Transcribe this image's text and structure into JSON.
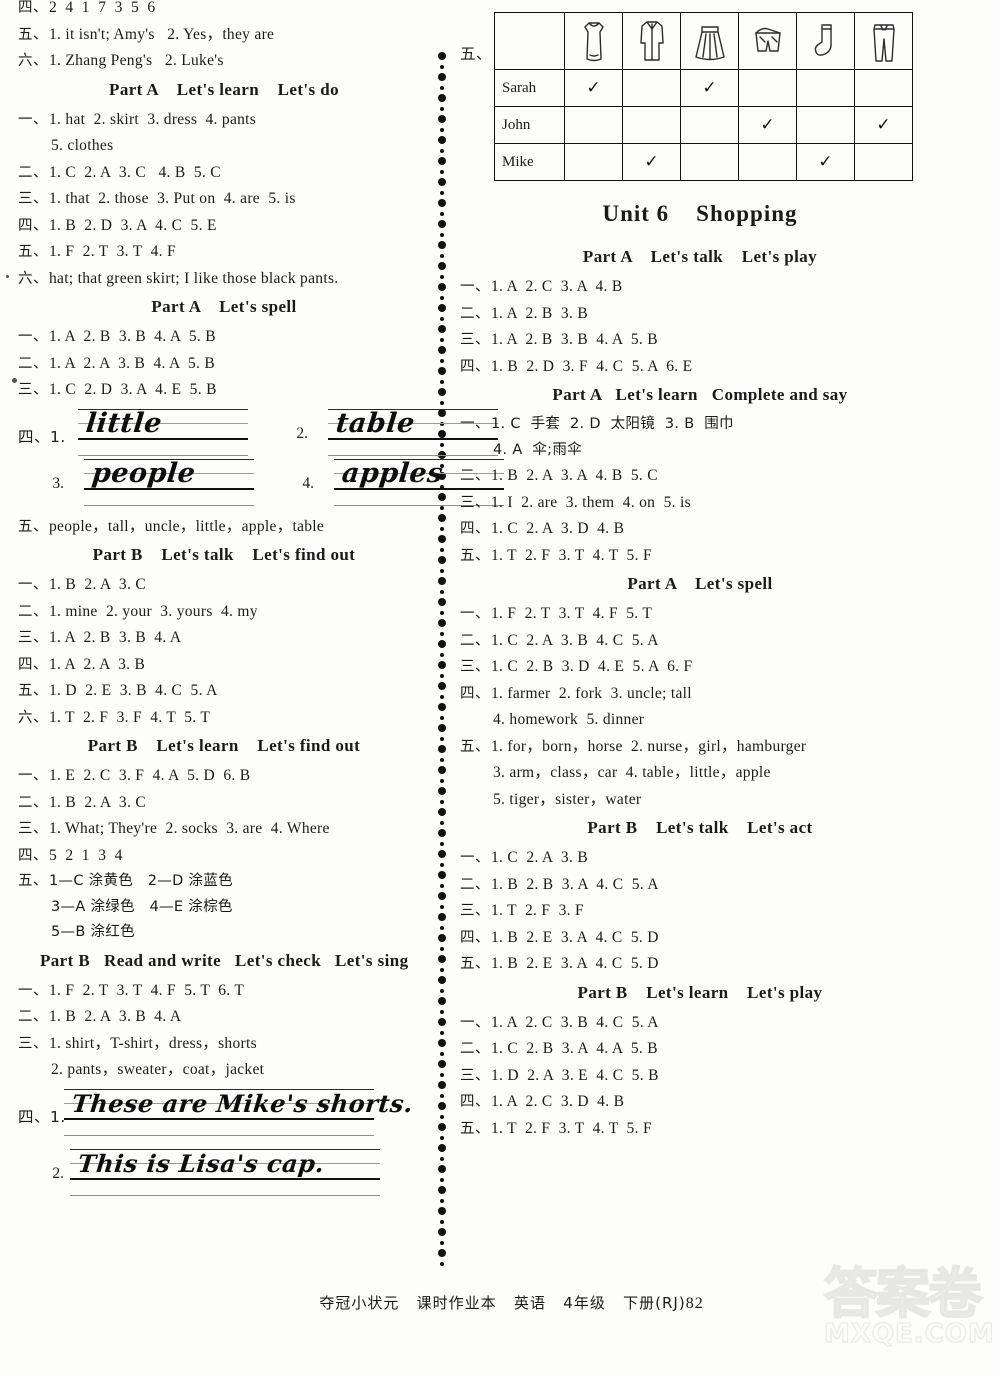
{
  "left_column": [
    {
      "kind": "answer",
      "num": "四、",
      "text": "2  4  1  7  3  5  6"
    },
    {
      "kind": "answer",
      "num": "五、",
      "text": "1. it isn't; Amy's   2. Yes，they are"
    },
    {
      "kind": "answer",
      "num": "六、",
      "text": "1. Zhang Peng's   2. Luke's"
    },
    {
      "kind": "heading",
      "text": "Part A    Let's learn    Let's do"
    },
    {
      "kind": "answer",
      "num": "一、",
      "text": "1. hat  2. skirt  3. dress  4. pants"
    },
    {
      "kind": "answer_indent",
      "text": "5. clothes"
    },
    {
      "kind": "answer",
      "num": "二、",
      "text": "1. C  2. A  3. C   4. B  5. C"
    },
    {
      "kind": "answer",
      "num": "三、",
      "text": "1. that  2. those  3. Put on  4. are  5. is"
    },
    {
      "kind": "answer",
      "num": "四、",
      "text": "1. B  2. D  3. A  4. C  5. E"
    },
    {
      "kind": "answer",
      "num": "五、",
      "text": "1. F  2. T  3. T  4. F"
    },
    {
      "kind": "answer",
      "num": "六、",
      "text": "hat; that green skirt; I like those black pants."
    },
    {
      "kind": "heading",
      "text": "Part A    Let's spell"
    },
    {
      "kind": "answer",
      "num": "一、",
      "text": "1. A  2. B  3. B  4. A  5. B"
    },
    {
      "kind": "answer",
      "num": "二、",
      "text": "1. A  2. A  3. B  4. A  5. B"
    },
    {
      "kind": "answer",
      "num": "三、",
      "text": "1. C  2. D  3. A  4. E  5. B"
    },
    {
      "kind": "handwriting_grid",
      "num": "四、",
      "items": [
        {
          "label": "1.",
          "word": "little"
        },
        {
          "label": "2.",
          "word": "table"
        },
        {
          "label": "3.",
          "word": "people"
        },
        {
          "label": "4.",
          "word": "apples"
        }
      ]
    },
    {
      "kind": "answer",
      "num": "五、",
      "text": "people，tall，uncle，little，apple，table"
    },
    {
      "kind": "heading",
      "text": "Part B    Let's talk    Let's find out"
    },
    {
      "kind": "answer",
      "num": "一、",
      "text": "1. B  2. A  3. C"
    },
    {
      "kind": "answer",
      "num": "二、",
      "text": "1. mine  2. your  3. yours  4. my"
    },
    {
      "kind": "answer",
      "num": "三、",
      "text": "1. A  2. B  3. B  4. A"
    },
    {
      "kind": "answer",
      "num": "四、",
      "text": "1. A  2. A  3. B"
    },
    {
      "kind": "answer",
      "num": "五、",
      "text": "1. D  2. E  3. B  4. C  5. A"
    },
    {
      "kind": "answer",
      "num": "六、",
      "text": "1. T  2. F  3. F  4. T  5. T"
    },
    {
      "kind": "heading",
      "text": "Part B    Let's learn    Let's find out"
    },
    {
      "kind": "answer",
      "num": "一、",
      "text": "1. E  2. C  3. F  4. A  5. D  6. B"
    },
    {
      "kind": "answer",
      "num": "二、",
      "text": "1. B  2. A  3. C"
    },
    {
      "kind": "answer",
      "num": "三、",
      "text": "1. What; They're  2. socks  3. are  4. Where"
    },
    {
      "kind": "answer",
      "num": "四、",
      "text": "5  2  1  3  4"
    },
    {
      "kind": "answer_cn",
      "num": "五、",
      "text": "1—C 涂黄色   2—D 涂蓝色"
    },
    {
      "kind": "answer_indent_cn",
      "text": "3—A 涂绿色   4—E 涂棕色"
    },
    {
      "kind": "answer_indent_cn",
      "text": "5—B 涂红色"
    },
    {
      "kind": "heading_left",
      "text": "Part B   Read and write   Let's check   Let's sing"
    },
    {
      "kind": "answer",
      "num": "一、",
      "text": "1. F  2. T  3. T  4. F  5. T  6. T"
    },
    {
      "kind": "answer",
      "num": "二、",
      "text": "1. B  2. A  3. B  4. A"
    },
    {
      "kind": "answer",
      "num": "三、",
      "text": "1. shirt，T-shirt，dress，shorts"
    },
    {
      "kind": "answer_indent",
      "text": "2. pants，sweater，coat，jacket"
    },
    {
      "kind": "handwriting_sentences",
      "num": "四、",
      "items": [
        {
          "label": "1.",
          "word": "These are Mike's shorts."
        },
        {
          "label": "2.",
          "word": "This is Lisa's cap."
        }
      ]
    }
  ],
  "right_column": {
    "table_block": {
      "lead": "五、",
      "column_icons": [
        "dress-icon",
        "jacket-icon",
        "skirt-icon",
        "shorts-icon",
        "sock-icon",
        "pants-icon"
      ],
      "rows": [
        {
          "name": "Sarah",
          "marks": [
            true,
            false,
            true,
            false,
            false,
            false
          ]
        },
        {
          "name": "John",
          "marks": [
            false,
            false,
            false,
            true,
            false,
            true
          ]
        },
        {
          "name": "Mike",
          "marks": [
            false,
            true,
            false,
            false,
            true,
            false
          ]
        }
      ],
      "tick_glyph": "✓"
    },
    "unit_title": "Unit 6    Shopping",
    "items": [
      {
        "kind": "heading",
        "text": "Part A    Let's talk    Let's play"
      },
      {
        "kind": "answer",
        "num": "一、",
        "text": "1. A  2. C  3. A  4. B"
      },
      {
        "kind": "answer",
        "num": "二、",
        "text": "1. A  2. B  3. B"
      },
      {
        "kind": "answer",
        "num": "三、",
        "text": "1. A  2. B  3. B  4. A  5. B"
      },
      {
        "kind": "answer",
        "num": "四、",
        "text": "1. B  2. D  3. F  4. C  5. A  6. E"
      },
      {
        "kind": "heading",
        "text": "Part A   Let's learn   Complete and say"
      },
      {
        "kind": "answer_cn",
        "num": "一、",
        "text": "1. C  手套  2. D  太阳镜  3. B  围巾"
      },
      {
        "kind": "answer_indent_cn",
        "text": "4. A  伞;雨伞"
      },
      {
        "kind": "answer",
        "num": "二、",
        "text": "1. B  2. A  3. A  4. B  5. C"
      },
      {
        "kind": "answer",
        "num": "三、",
        "text": "1. I  2. are  3. them  4. on  5. is"
      },
      {
        "kind": "answer",
        "num": "四、",
        "text": "1. C  2. A  3. D  4. B"
      },
      {
        "kind": "answer",
        "num": "五、",
        "text": "1. T  2. F  3. T  4. T  5. F"
      },
      {
        "kind": "heading",
        "text": "Part A    Let's spell"
      },
      {
        "kind": "answer",
        "num": "一、",
        "text": "1. F  2. T  3. T  4. F  5. T"
      },
      {
        "kind": "answer",
        "num": "二、",
        "text": "1. C  2. A  3. B  4. C  5. A"
      },
      {
        "kind": "answer",
        "num": "三、",
        "text": "1. C  2. B  3. D  4. E  5. A  6. F"
      },
      {
        "kind": "answer",
        "num": "四、",
        "text": "1. farmer  2. fork  3. uncle; tall"
      },
      {
        "kind": "answer_indent",
        "text": "4. homework  5. dinner"
      },
      {
        "kind": "answer",
        "num": "五、",
        "text": "1. for，born，horse  2. nurse，girl，hamburger"
      },
      {
        "kind": "answer_indent",
        "text": "3. arm，class，car  4. table，little，apple"
      },
      {
        "kind": "answer_indent",
        "text": "5. tiger，sister，water"
      },
      {
        "kind": "heading",
        "text": "Part B    Let's talk    Let's act"
      },
      {
        "kind": "answer",
        "num": "一、",
        "text": "1. C  2. A  3. B"
      },
      {
        "kind": "answer",
        "num": "二、",
        "text": "1. B  2. B  3. A  4. C  5. A"
      },
      {
        "kind": "answer",
        "num": "三、",
        "text": "1. T  2. F  3. F"
      },
      {
        "kind": "answer",
        "num": "四、",
        "text": "1. B  2. E  3. A  4. C  5. D"
      },
      {
        "kind": "answer",
        "num": "五、",
        "text": "1. B  2. E  3. A  4. C  5. D"
      },
      {
        "kind": "heading",
        "text": "Part B    Let's learn    Let's play"
      },
      {
        "kind": "answer",
        "num": "一、",
        "text": "1. A  2. C  3. B  4. C  5. A"
      },
      {
        "kind": "answer",
        "num": "二、",
        "text": "1. C  2. B  3. A  4. A  5. B"
      },
      {
        "kind": "answer",
        "num": "三、",
        "text": "1. D  2. A  3. E  4. C  5. B"
      },
      {
        "kind": "answer",
        "num": "四、",
        "text": "1. A  2. C  3. D  4. B"
      },
      {
        "kind": "answer",
        "num": "五、",
        "text": "1. T  2. F  3. T  4. T  5. F"
      }
    ]
  },
  "footer": {
    "line": "夺冠小状元   课时作业本   英语   4年级   下册(RJ)",
    "page_number": "82"
  },
  "watermark": {
    "cn": "答案卷",
    "url": "MXQE.COM"
  }
}
